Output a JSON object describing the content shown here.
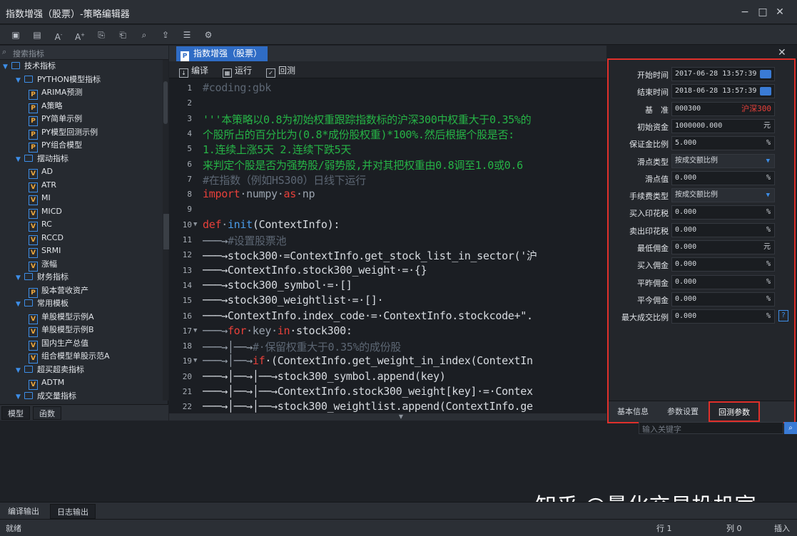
{
  "window": {
    "title": "指数增强（股票）-策略编辑器",
    "minimize": "−",
    "maximize": "□",
    "close": "✕"
  },
  "toolbar": {
    "icons": [
      "save-icon",
      "save-all-icon",
      "font-decrease-icon",
      "font-increase-icon",
      "import-icon",
      "export-icon",
      "search-file-icon",
      "upload-icon",
      "report-icon",
      "settings-file-icon"
    ]
  },
  "sidebar": {
    "search_placeholder": "搜索指标",
    "tree": [
      {
        "level": 0,
        "type": "folder",
        "label": "技术指标"
      },
      {
        "level": 1,
        "type": "folder",
        "label": "PYTHON模型指标"
      },
      {
        "level": 2,
        "type": "p",
        "label": "ARIMA预测"
      },
      {
        "level": 2,
        "type": "p",
        "label": "A策略"
      },
      {
        "level": 2,
        "type": "p",
        "label": "PY简单示例"
      },
      {
        "level": 2,
        "type": "p",
        "label": "PY模型回测示例"
      },
      {
        "level": 2,
        "type": "p",
        "label": "PY组合模型"
      },
      {
        "level": 1,
        "type": "folder",
        "label": "摆动指标"
      },
      {
        "level": 2,
        "type": "v",
        "label": "AD"
      },
      {
        "level": 2,
        "type": "v",
        "label": "ATR"
      },
      {
        "level": 2,
        "type": "v",
        "label": "MI"
      },
      {
        "level": 2,
        "type": "v",
        "label": "MICD"
      },
      {
        "level": 2,
        "type": "v",
        "label": "RC"
      },
      {
        "level": 2,
        "type": "v",
        "label": "RCCD"
      },
      {
        "level": 2,
        "type": "v",
        "label": "SRMI"
      },
      {
        "level": 2,
        "type": "v",
        "label": "涨幅"
      },
      {
        "level": 1,
        "type": "folder",
        "label": "财务指标"
      },
      {
        "level": 2,
        "type": "p",
        "label": "股本营收资产"
      },
      {
        "level": 1,
        "type": "folder",
        "label": "常用模板"
      },
      {
        "level": 2,
        "type": "v",
        "label": "单股模型示例A"
      },
      {
        "level": 2,
        "type": "v",
        "label": "单股模型示例B"
      },
      {
        "level": 2,
        "type": "v",
        "label": "国内生产总值"
      },
      {
        "level": 2,
        "type": "v",
        "label": "组合模型单股示范A"
      },
      {
        "level": 1,
        "type": "folder",
        "label": "超买超卖指标"
      },
      {
        "level": 2,
        "type": "v",
        "label": "ADTM"
      },
      {
        "level": 1,
        "type": "folder",
        "label": "成交量指标"
      }
    ],
    "tabs": [
      "模型",
      "函数"
    ]
  },
  "editor": {
    "tab_label": "指数增强（股票）",
    "tab_icon": "P",
    "tools": {
      "compile": "编译",
      "run": "运行",
      "backtest": "回测"
    },
    "lines": [
      {
        "n": "1",
        "code": [
          {
            "t": "#coding:gbk",
            "c": "cmt"
          }
        ]
      },
      {
        "n": "2",
        "code": []
      },
      {
        "n": "3",
        "code": [
          {
            "t": "'''本策略以0.8为初始权重跟踪指数标的沪深300中权重大于0.35%的",
            "c": "str"
          }
        ]
      },
      {
        "n": "4",
        "code": [
          {
            "t": "个股所占的百分比为(0.8*成份股权重)*100%.然后根据个股是否:",
            "c": "str"
          }
        ]
      },
      {
        "n": "5",
        "code": [
          {
            "t": "1.连续上涨5天 2.连续下跌5天",
            "c": "str"
          }
        ]
      },
      {
        "n": "6",
        "code": [
          {
            "t": "来判定个股是否为强势股/弱势股,并对其把权重由0.8调至1.0或0.6",
            "c": "str"
          }
        ]
      },
      {
        "n": "7",
        "code": [
          {
            "t": "#在指数（例如HS300）日线下运行",
            "c": "cmt"
          }
        ]
      },
      {
        "n": "8",
        "code": [
          {
            "t": "import",
            "c": "kw"
          },
          {
            "t": "·numpy·",
            "c": "idt"
          },
          {
            "t": "as",
            "c": "kw"
          },
          {
            "t": "·np",
            "c": "idt"
          }
        ]
      },
      {
        "n": "9",
        "code": []
      },
      {
        "n": "10",
        "fold": "▼",
        "code": [
          {
            "t": "def",
            "c": "kw"
          },
          {
            "t": "·",
            "c": "idt"
          },
          {
            "t": "init",
            "c": "fn"
          },
          {
            "t": "(ContextInfo):",
            "c": ""
          }
        ]
      },
      {
        "n": "11",
        "code": [
          {
            "t": "───→",
            "c": "idt"
          },
          {
            "t": "#设置股票池",
            "c": "cmt"
          }
        ]
      },
      {
        "n": "12",
        "code": [
          {
            "t": "───→stock300·=ContextInfo.get_stock_list_in_sector('沪",
            "c": ""
          }
        ]
      },
      {
        "n": "13",
        "code": [
          {
            "t": "───→ContextInfo.stock300_weight·=·{}",
            "c": ""
          }
        ]
      },
      {
        "n": "14",
        "code": [
          {
            "t": "───→stock300_symbol·=·[]",
            "c": ""
          }
        ]
      },
      {
        "n": "15",
        "code": [
          {
            "t": "───→stock300_weightlist·=·[]·",
            "c": ""
          }
        ]
      },
      {
        "n": "16",
        "code": [
          {
            "t": "───→ContextInfo.index_code·=·ContextInfo.stockcode+\".",
            "c": ""
          }
        ]
      },
      {
        "n": "17",
        "fold": "▼",
        "code": [
          {
            "t": "───→",
            "c": "idt"
          },
          {
            "t": "for",
            "c": "kw"
          },
          {
            "t": "·key·",
            "c": "idt"
          },
          {
            "t": "in",
            "c": "kw"
          },
          {
            "t": "·stock300:",
            "c": ""
          }
        ]
      },
      {
        "n": "18",
        "code": [
          {
            "t": "───→│──→",
            "c": "idt"
          },
          {
            "t": "#·保留权重大于0.35%的成份股",
            "c": "cmt"
          }
        ]
      },
      {
        "n": "19",
        "fold": "▼",
        "code": [
          {
            "t": "───→│──→",
            "c": "idt"
          },
          {
            "t": "if",
            "c": "kw"
          },
          {
            "t": "·(ContextInfo.get_weight_in_index(ContextIn",
            "c": ""
          }
        ]
      },
      {
        "n": "20",
        "code": [
          {
            "t": "───→│──→│──→stock300_symbol.append(key)",
            "c": ""
          }
        ]
      },
      {
        "n": "21",
        "code": [
          {
            "t": "───→│──→│──→ContextInfo.stock300_weight[key]·=·Contex",
            "c": ""
          }
        ]
      },
      {
        "n": "22",
        "code": [
          {
            "t": "───→│──→│──→stock300_weightlist.append(ContextInfo.ge",
            "c": ""
          }
        ]
      }
    ]
  },
  "params": {
    "rows": [
      {
        "label": "开始时间",
        "value": "2017-06-28 13:57:39",
        "kind": "cal"
      },
      {
        "label": "结束时间",
        "value": "2018-06-28 13:57:39",
        "kind": "cal"
      },
      {
        "label": "基　准",
        "value": "000300",
        "kind": "red",
        "extra": "沪深300"
      },
      {
        "label": "初始资金",
        "value": "1000000.000",
        "kind": "unit",
        "extra": "元"
      },
      {
        "label": "保证金比例",
        "value": "5.000",
        "kind": "unit",
        "extra": "%"
      },
      {
        "label": "滑点类型",
        "value": "按成交额比例",
        "kind": "dd",
        "extra": "▼"
      },
      {
        "label": "滑点值",
        "value": "0.000",
        "kind": "unit",
        "extra": "%"
      },
      {
        "label": "手续费类型",
        "value": "按成交额比例",
        "kind": "dd",
        "extra": "▼"
      },
      {
        "label": "买入印花税",
        "value": "0.000",
        "kind": "unit",
        "extra": "%"
      },
      {
        "label": "卖出印花税",
        "value": "0.000",
        "kind": "unit",
        "extra": "%"
      },
      {
        "label": "最低佣金",
        "value": "0.000",
        "kind": "unit",
        "extra": "元"
      },
      {
        "label": "买入佣金",
        "value": "0.000",
        "kind": "unit",
        "extra": "%"
      },
      {
        "label": "平昨佣金",
        "value": "0.000",
        "kind": "unit",
        "extra": "%"
      },
      {
        "label": "平今佣金",
        "value": "0.000",
        "kind": "unit",
        "extra": "%"
      },
      {
        "label": "最大成交比例",
        "value": "0.000",
        "kind": "unit",
        "extra": "%"
      }
    ],
    "help": "?",
    "tabs": {
      "basic": "基本信息",
      "settings": "参数设置",
      "backtest": "回测参数"
    },
    "search_placeholder": "输入关键字",
    "search_icon": "magnifier-icon"
  },
  "output": {
    "tabs": [
      "编译输出",
      "日志输出"
    ]
  },
  "status": {
    "ready": "就绪",
    "row": "行 1",
    "col": "列 0",
    "mode": "插入"
  },
  "watermark": "知乎 @量化交易投机室",
  "colors": {
    "accent": "#2f6cc5",
    "highlight": "#e0302b",
    "string": "#26b446",
    "keyword": "#e8403a"
  }
}
